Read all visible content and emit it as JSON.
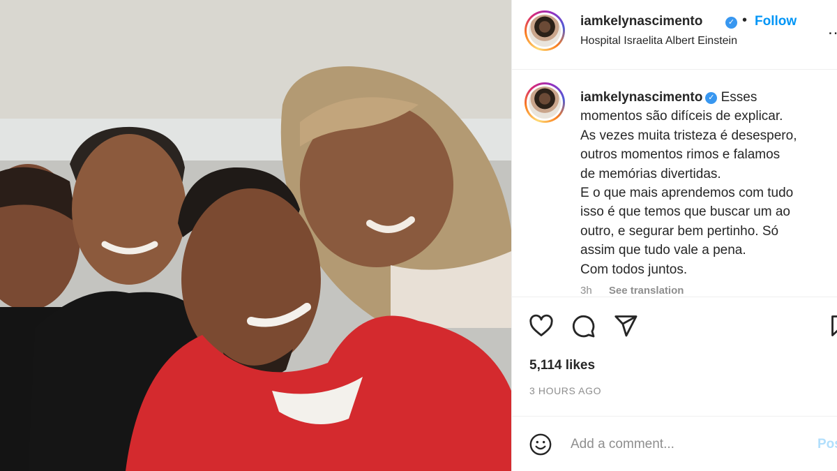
{
  "post": {
    "username": "iamkelynascimento",
    "verified_icon": "verified-badge-icon",
    "dot": "•",
    "follow_label": "Follow",
    "location": "Hospital Israelita Albert Einstein",
    "more_icon": "more-options-icon",
    "more_glyph": "…",
    "caption_lines": [
      "Esses",
      "momentos são difíceis de explicar.",
      "As vezes muita tristeza é desespero,",
      "outros momentos rimos e falamos",
      "de memórias divertidas.",
      "E o que mais aprendemos com tudo",
      "isso é que temos que buscar um ao",
      "outro, e segurar bem pertinho. Só",
      "assim que tudo vale a pena.",
      "Com todos juntos."
    ],
    "caption_age": "3h",
    "see_translation": "See translation",
    "likes": "5,114 likes",
    "timestamp": "3 HOURS AGO",
    "comment_placeholder": "Add a comment...",
    "post_label": "Post"
  },
  "icons": {
    "like": "heart-icon",
    "comment": "comment-icon",
    "share": "send-icon",
    "save": "bookmark-icon",
    "emoji": "emoji-icon"
  },
  "colors": {
    "link_blue": "#0095f6",
    "verified_blue": "#3897f0",
    "muted_gray": "#8e8e8e",
    "post_disabled": "#b2dffc"
  }
}
